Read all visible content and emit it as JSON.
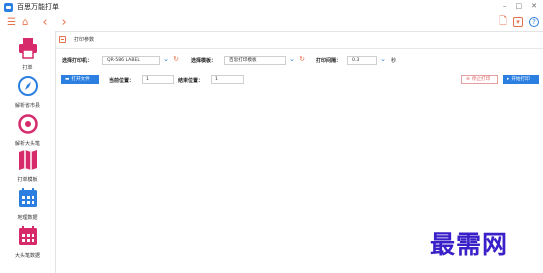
{
  "app": {
    "title": "百思万能打单",
    "window_buttons": {
      "minimize": "–",
      "maximize": "□",
      "close": "✕"
    }
  },
  "toolbar": {
    "menu_icon": "☰",
    "home_icon": "⌂",
    "back_icon": "‹",
    "forward_icon": "›",
    "doc_icon": "🗋",
    "dropdown_icon": "▾",
    "help_icon": "?"
  },
  "sidebar": {
    "items": [
      {
        "label": "打单",
        "icon": "printer-icon"
      },
      {
        "label": "解析省市县",
        "icon": "compass-icon"
      },
      {
        "label": "解析大头笔",
        "icon": "target-icon"
      },
      {
        "label": "打单模板",
        "icon": "map-icon"
      },
      {
        "label": "地理数据",
        "icon": "calendar-icon"
      },
      {
        "label": "大头笔数据",
        "icon": "calendar-icon"
      }
    ]
  },
  "panel": {
    "title": "打印参数",
    "printer_label": "选择打印机：",
    "printer_value": "QR-586 LABEL",
    "template_label": "选择模板：",
    "template_value": "百思打印模板",
    "interval_label": "打印间隔：",
    "interval_value": "0.3",
    "interval_unit": "秒",
    "open_file_label": "打开文件",
    "current_pos_label": "当前位置：",
    "current_pos_value": "1",
    "end_pos_label": "结束位置：",
    "end_pos_value": "1",
    "stop_label": "停止打印",
    "start_label": "开始打印"
  },
  "watermark": "最需网",
  "colors": {
    "accent_blue": "#2b7fe0",
    "accent_orange": "#e6704b",
    "sidebar_icon": "#d62a6a",
    "watermark": "#3a20c8"
  }
}
